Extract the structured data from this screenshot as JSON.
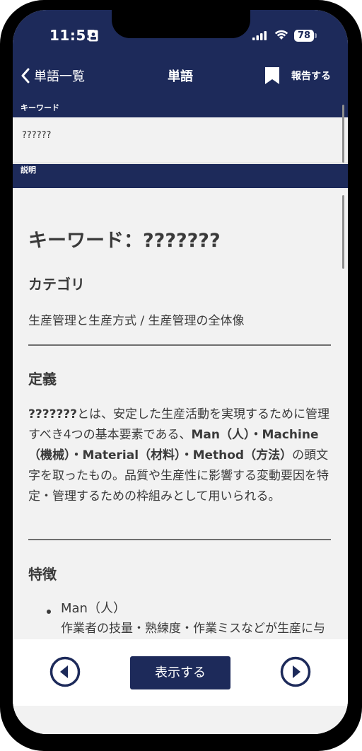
{
  "status": {
    "time": "11:55",
    "battery": "78"
  },
  "nav": {
    "back_label": "単語一覧",
    "title": "単語",
    "report_label": "報告する"
  },
  "sections": {
    "keyword_header": "キーワード",
    "keyword_value": "??????",
    "description_header": "説明"
  },
  "doc": {
    "title": "キーワード：???????",
    "category_heading": "カテゴリ",
    "category_text": "生産管理と生産方式 / 生産管理の全体像",
    "definition_heading": "定義",
    "definition_bold_term": "???????",
    "definition_text_1": "とは、安定した生産活動を実現するために管理すべき4つの基本要素である、",
    "definition_man": "Man（人）",
    "definition_sep_1": "・",
    "definition_machine": "Machine（機械）",
    "definition_sep_2": "・",
    "definition_material": "Material（材料）",
    "definition_sep_3": "・",
    "definition_method": "Method（方法）",
    "definition_text_2": "の頭文字を取ったもの。品質や生産性に影響する変動要因を特定・管理するための枠組みとして用いられる。",
    "features_heading": "特徴",
    "feature_1_title": "Man（人）",
    "feature_1_text": "作業者の技量・熟練度・作業ミスなどが生産に与える影響を管理。教育・訓練の充実や標"
  },
  "bottom": {
    "show_label": "表示する"
  },
  "colors": {
    "navy": "#1d2a5a",
    "background": "#f2f2f2",
    "text": "#3a3a3a"
  },
  "icons": {
    "back": "chevron-left-icon",
    "bookmark": "bookmark-icon",
    "prev": "circle-prev-icon",
    "next": "circle-next-icon"
  }
}
